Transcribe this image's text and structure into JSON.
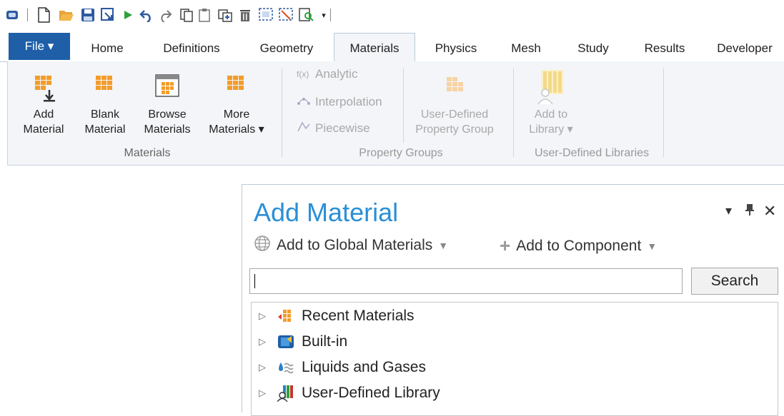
{
  "tabs": [
    "File ▾",
    "Home",
    "Definitions",
    "Geometry",
    "Materials",
    "Physics",
    "Mesh",
    "Study",
    "Results",
    "Developer"
  ],
  "ribbon": {
    "add_material": [
      "Add",
      "Material"
    ],
    "blank_material": [
      "Blank",
      "Material"
    ],
    "browse_materials": [
      "Browse",
      "Materials"
    ],
    "more_materials": [
      "More",
      "Materials ▾"
    ],
    "group_materials": "Materials",
    "analytic": "Analytic",
    "interpolation": "Interpolation",
    "piecewise": "Piecewise",
    "user_defined_group": [
      "User-Defined",
      "Property Group"
    ],
    "group_property": "Property Groups",
    "add_to_library": [
      "Add to",
      "Library ▾"
    ],
    "group_libraries": "User-Defined Libraries"
  },
  "panel": {
    "title": "Add Material",
    "add_global": "Add to Global Materials",
    "add_component": "Add to Component",
    "search_value": "",
    "search_button": "Search",
    "tree": [
      "Recent Materials",
      "Built-in",
      "Liquids and Gases",
      "User-Defined Library"
    ]
  },
  "colors": {
    "accent": "#1e5fa8",
    "title": "#2a8fd6",
    "material_orange": "#f39c2b"
  }
}
